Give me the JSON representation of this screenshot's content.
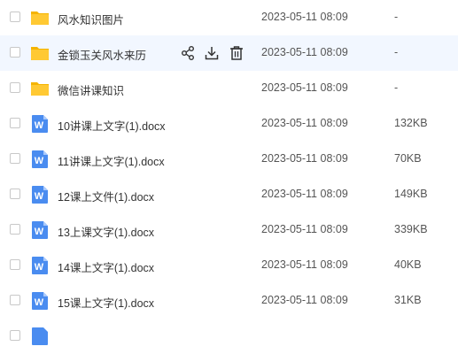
{
  "files": [
    {
      "name": "风水知识图片",
      "date": "2023-05-11 08:09",
      "size": "-",
      "type": "folder"
    },
    {
      "name": "金锁玉关风水来历",
      "date": "2023-05-11 08:09",
      "size": "-",
      "type": "folder",
      "hovered": true
    },
    {
      "name": "微信讲课知识",
      "date": "2023-05-11 08:09",
      "size": "-",
      "type": "folder"
    },
    {
      "name": "10讲课上文字(1).docx",
      "date": "2023-05-11 08:09",
      "size": "132KB",
      "type": "docx"
    },
    {
      "name": "11讲课上文字(1).docx",
      "date": "2023-05-11 08:09",
      "size": "70KB",
      "type": "docx"
    },
    {
      "name": "12课上文件(1).docx",
      "date": "2023-05-11 08:09",
      "size": "149KB",
      "type": "docx"
    },
    {
      "name": "13上课文字(1).docx",
      "date": "2023-05-11 08:09",
      "size": "339KB",
      "type": "docx"
    },
    {
      "name": "14课上文字(1).docx",
      "date": "2023-05-11 08:09",
      "size": "40KB",
      "type": "docx"
    },
    {
      "name": "15课上文字(1).docx",
      "date": "2023-05-11 08:09",
      "size": "31KB",
      "type": "docx"
    }
  ],
  "row_actions": [
    "share-icon",
    "download-icon",
    "delete-icon"
  ],
  "word_icon_letter": "W",
  "colors": {
    "folder": "#ffc933",
    "word": "#4a8cf0",
    "hover_row": "#f2f7ff"
  }
}
